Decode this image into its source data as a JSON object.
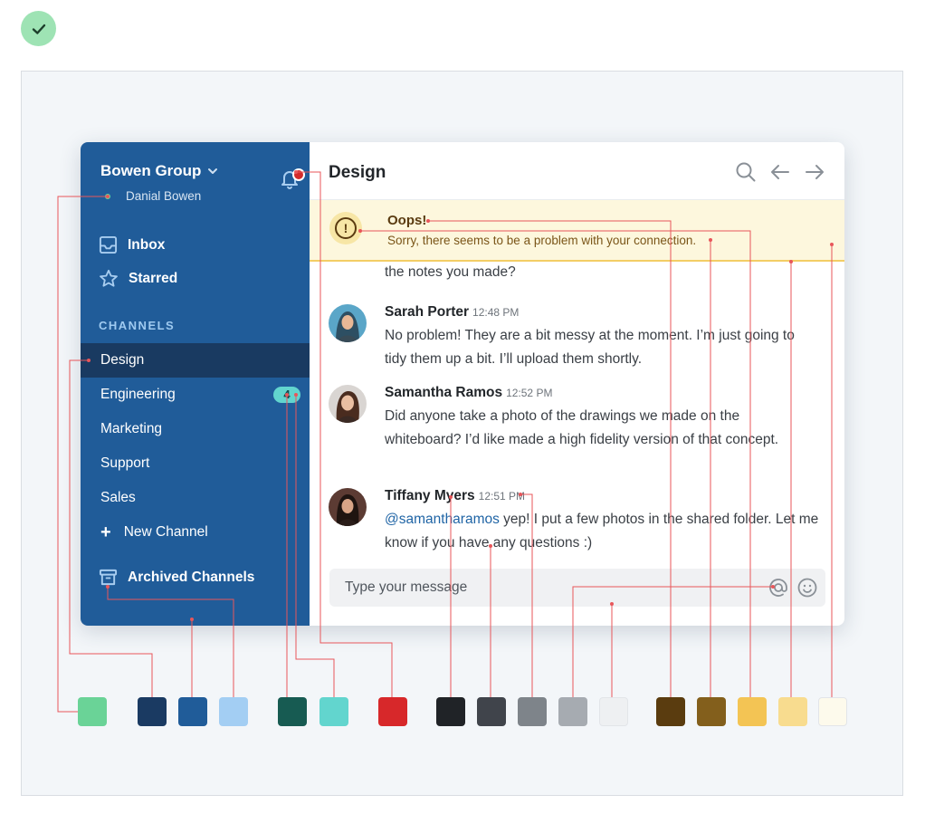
{
  "workspace": {
    "name": "Bowen Group",
    "user": "Danial Bowen"
  },
  "nav": {
    "inbox": "Inbox",
    "starred": "Starred"
  },
  "channels_header": "CHANNELS",
  "channels": [
    {
      "label": "Design",
      "active": true
    },
    {
      "label": "Engineering",
      "badge": "4"
    },
    {
      "label": "Marketing"
    },
    {
      "label": "Support"
    },
    {
      "label": "Sales"
    }
  ],
  "new_channel": "New Channel",
  "archived_channels": "Archived Channels",
  "main": {
    "title": "Design"
  },
  "alert": {
    "title": "Oops!",
    "message": "Sorry, there seems to be a problem with your connection."
  },
  "partial_message": "the notes you made?",
  "messages": [
    {
      "name": "Sarah Porter",
      "time": "12:48 PM",
      "text": "No problem! They are a bit messy at the moment. I’m just going to tidy them up a bit. I’ll upload them shortly."
    },
    {
      "name": "Samantha Ramos",
      "time": "12:52 PM",
      "text": "Did anyone take a photo of the drawings we made on the whiteboard? I’d like made a high fidelity version of that concept."
    },
    {
      "name": "Tiffany Myers",
      "time": "12:51 PM",
      "mention": "@samantharamos",
      "text": " yep! I put a few photos in the shared folder. Let me know if you have any questions :)"
    }
  ],
  "composer": {
    "placeholder": "Type your message"
  },
  "icons": [
    "check-icon",
    "chevron-down-icon",
    "bell-icon",
    "inbox-icon",
    "star-icon",
    "plus-icon",
    "archive-icon",
    "search-icon",
    "arrow-left-icon",
    "arrow-right-icon",
    "alert-icon",
    "at-icon",
    "emoji-icon"
  ],
  "palette": [
    "#6ad397",
    "#1a3a62",
    "#205c99",
    "#a3cef3",
    "#175b52",
    "#62d5ce",
    "#d7282a",
    "#202327",
    "#40444b",
    "#7e848a",
    "#a6abb1",
    "#eef0f2",
    "#5a3c0f",
    "#835f1c",
    "#f3c454",
    "#f8dc8f",
    "#fdfaec"
  ],
  "colors": {
    "sidebar": "#205c99",
    "sidebar_active": "#193a61",
    "accent_badge": "#62d5ce",
    "alert_bg": "#fdf7dd",
    "alert_border": "#f3cd65",
    "notification_red": "#d32b2b",
    "leader_lines": "#e8565a"
  }
}
